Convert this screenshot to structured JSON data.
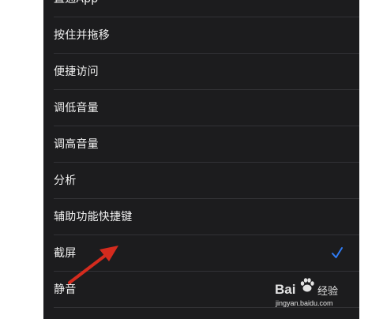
{
  "settings_list": {
    "items": [
      {
        "label": "直通App"
      },
      {
        "label": "按住并拖移"
      },
      {
        "label": "便捷访问"
      },
      {
        "label": "调低音量"
      },
      {
        "label": "调高音量"
      },
      {
        "label": "分析"
      },
      {
        "label": "辅助功能快捷键"
      },
      {
        "label": "截屏",
        "selected": true
      },
      {
        "label": "静音"
      }
    ]
  },
  "colors": {
    "panel_background": "#1c1c1e",
    "text": "#f2f2f2",
    "separator": "#323236",
    "check_accent": "#2f7cf6",
    "annotation_arrow": "#d42b1e"
  },
  "icons": {
    "check": "checkmark-icon",
    "annotation": "red-arrow-annotation",
    "watermark_paw": "paw-icon"
  },
  "watermark": {
    "logo_left": "Bai",
    "brand": "经验",
    "url": "jingyan.baidu.com"
  }
}
